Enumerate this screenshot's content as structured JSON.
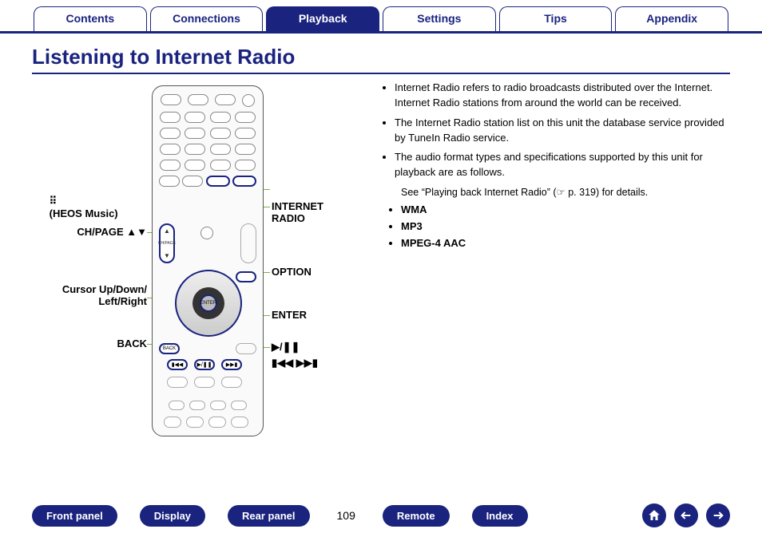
{
  "tabs": {
    "contents": "Contents",
    "connections": "Connections",
    "playback": "Playback",
    "settings": "Settings",
    "tips": "Tips",
    "appendix": "Appendix"
  },
  "title": "Listening to Internet Radio",
  "callouts": {
    "chpage": "CH/PAGE ▲▼",
    "cursor": "Cursor Up/Down/\nLeft/Right",
    "back": "BACK",
    "heos": "(HEOS Music)",
    "iradio": "INTERNET\nRADIO",
    "option": "OPTION",
    "enter": "ENTER",
    "playpause": "▶/❚❚",
    "skip": "▮◀◀ ▶▶▮"
  },
  "remote_labels": {
    "chpage_mid": "CH/PAGE",
    "enter": "ENTER",
    "back": "BACK"
  },
  "bullets": {
    "b1": "Internet Radio refers to radio broadcasts distributed over the Internet. Internet Radio stations from around the world can be received.",
    "b2": "The Internet Radio station list on this unit the database service provided by TuneIn Radio service.",
    "b3": "The audio format types and specifications supported by this unit for playback are as follows."
  },
  "see_text": "See “Playing back Internet Radio” (☞ p. 319) for details.",
  "formats": {
    "f1": "WMA",
    "f2": "MP3",
    "f3": "MPEG-4 AAC"
  },
  "footer": {
    "front": "Front panel",
    "display": "Display",
    "rear": "Rear panel",
    "page": "109",
    "remote": "Remote",
    "index": "Index"
  },
  "heos_icon_glyph": "⠿"
}
